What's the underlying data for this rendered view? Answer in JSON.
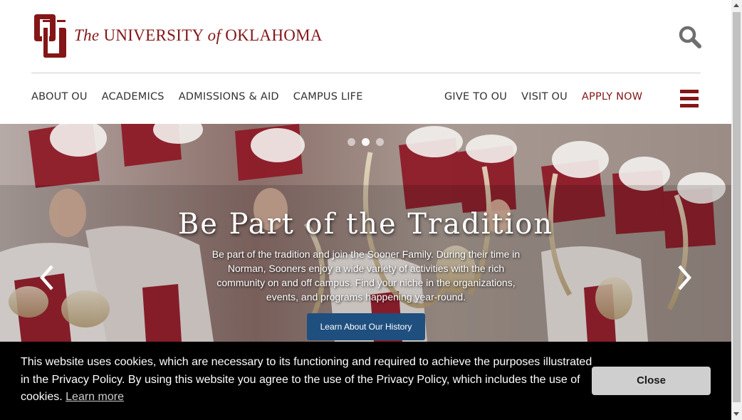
{
  "brand": {
    "logo_letters": "OU",
    "wordmark_the": "The",
    "wordmark_university": "UNIVERSITY",
    "wordmark_of": "of",
    "wordmark_state": "OKLAHOMA",
    "crimson": "#841617"
  },
  "header": {
    "search_icon": "search-icon",
    "menu_icon": "hamburger-menu-icon"
  },
  "nav": {
    "left": [
      {
        "label": "ABOUT OU"
      },
      {
        "label": "ACADEMICS"
      },
      {
        "label": "ADMISSIONS & AID"
      },
      {
        "label": "CAMPUS LIFE"
      }
    ],
    "right": [
      {
        "label": "GIVE TO OU"
      },
      {
        "label": "VISIT OU"
      },
      {
        "label": "APPLY NOW"
      }
    ]
  },
  "hero": {
    "title": "Be Part of the Tradition",
    "text": "Be part of the tradition and join the Sooner Family. During their time in Norman, Sooners enjoy a wide variety of activities with the rich community on and off campus. Find your niche in the organizations, events, and programs happening year-round.",
    "button_label": "Learn About Our History",
    "slide_count": 3,
    "active_slide": 1,
    "prev_icon": "chevron-left-icon",
    "next_icon": "chevron-right-icon",
    "button_color": "#1e4f7f"
  },
  "cookie": {
    "message": "This website uses cookies, which are necessary to its functioning and required to achieve the purposes illustrated in the Privacy Policy. By using this website you agree to the use of the Privacy Policy, which includes the use of cookies.",
    "learn_more": "Learn more",
    "close_label": "Close"
  }
}
